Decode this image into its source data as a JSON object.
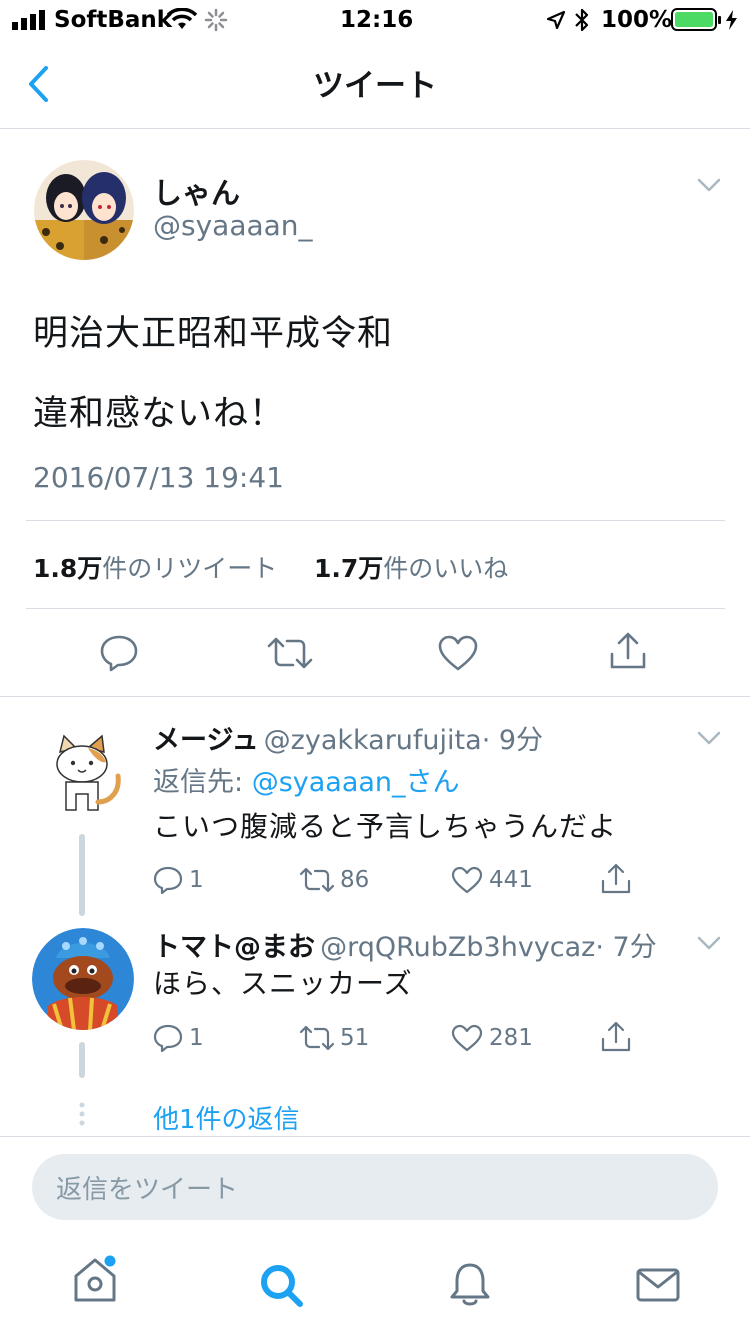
{
  "status_bar": {
    "carrier": "SoftBank",
    "time": "12:16",
    "battery": "100%"
  },
  "nav": {
    "title": "ツイート"
  },
  "tweet": {
    "display_name": "しゃん",
    "handle": "@syaaaan_",
    "text_line1": "明治大正昭和平成令和",
    "text_line2": "違和感ないね！",
    "timestamp": "2016/07/13 19:41",
    "retweet_count": "1.8万",
    "retweet_label": "件のリツイート",
    "like_count": "1.7万",
    "like_label": "件のいいね"
  },
  "replies": [
    {
      "display_name": "メージュ",
      "handle": "@zyakkarufujita",
      "time": "· 9分",
      "reply_to_label": "返信先:",
      "reply_to_handle": "@syaaaan_さん",
      "text": "こいつ腹減ると予言しちゃうんだよ",
      "reply_count": "1",
      "retweet_count": "86",
      "like_count": "441"
    },
    {
      "display_name": "トマト@まお",
      "handle": "@rqQRubZb3hvycaz",
      "time": "· 7分",
      "text": "ほら、スニッカーズ",
      "reply_count": "1",
      "retweet_count": "51",
      "like_count": "281"
    }
  ],
  "more_replies": "他1件の返信",
  "compose": {
    "placeholder": "返信をツイート"
  },
  "colors": {
    "accent": "#1da1f2",
    "secondary_text": "#657786",
    "divider": "#d7dde2",
    "battery_green": "#4cd964"
  },
  "tab_bar": [
    "home-icon",
    "search-icon",
    "notifications-icon",
    "messages-icon"
  ]
}
